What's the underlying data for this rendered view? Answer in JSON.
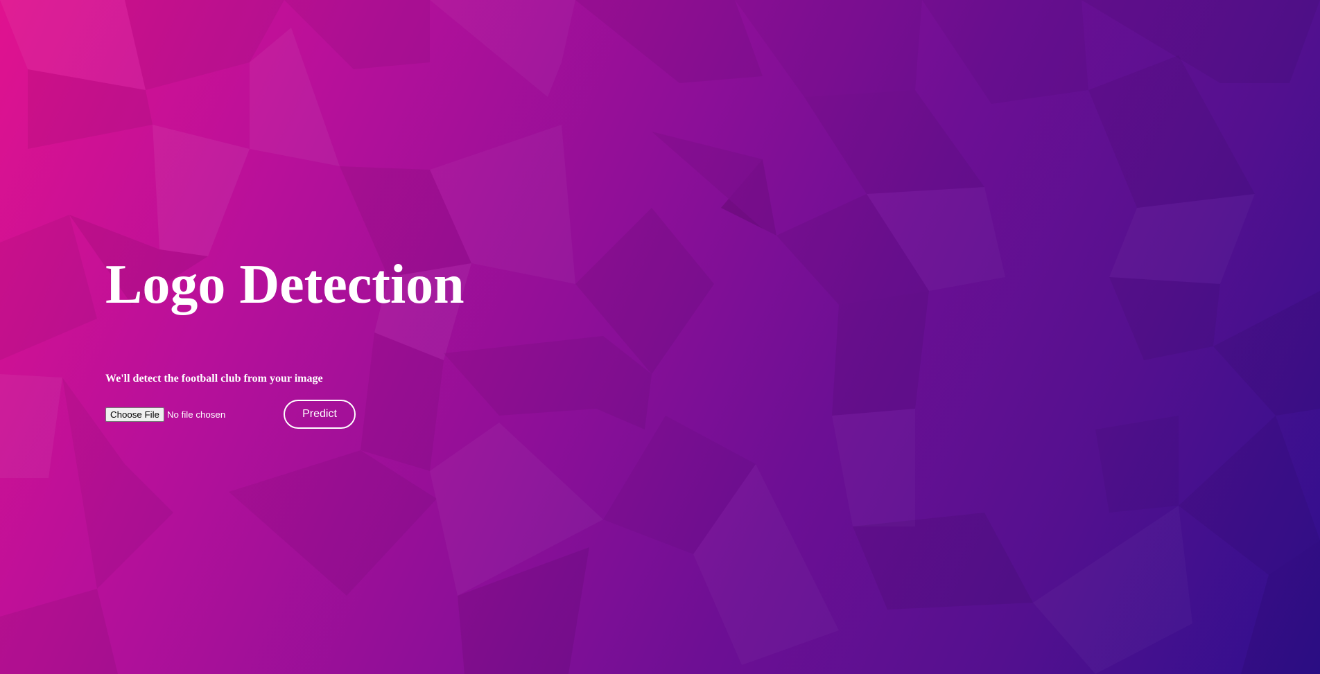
{
  "page": {
    "title": "Logo Detection",
    "subtitle": "We'll detect the football club from your image"
  },
  "upload": {
    "choose_label": "Choose File",
    "status_text": "No file chosen"
  },
  "actions": {
    "predict_label": "Predict"
  },
  "colors": {
    "background_start": "#e0128f",
    "background_end": "#2e0f8d",
    "text": "#ffffff",
    "button_border": "#ffffff"
  }
}
